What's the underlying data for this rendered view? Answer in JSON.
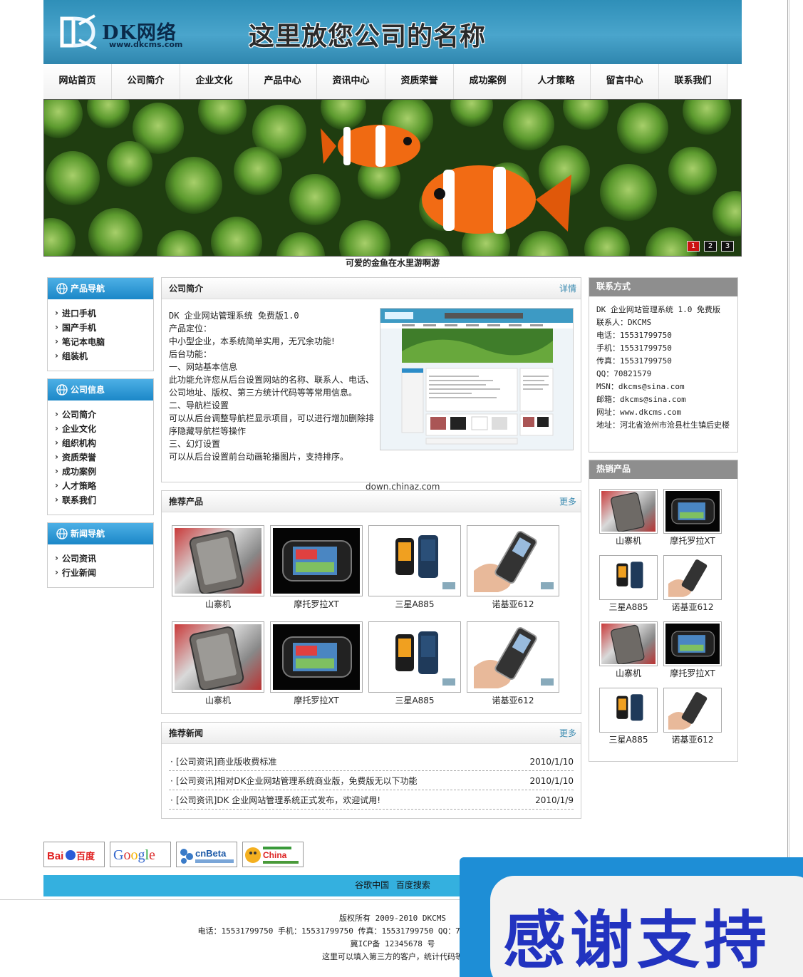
{
  "header": {
    "logo_brand": "DK网络",
    "logo_url": "www.dkcms.com",
    "company_name": "这里放您公司的名称"
  },
  "nav": [
    "网站首页",
    "公司简介",
    "企业文化",
    "产品中心",
    "资讯中心",
    "资质荣誉",
    "成功案例",
    "人才策略",
    "留言中心",
    "联系我们"
  ],
  "banner": {
    "caption": "可爱的金鱼在水里游啊游",
    "slides": [
      "1",
      "2",
      "3"
    ],
    "active_slide": 1
  },
  "left": {
    "product_nav": {
      "title": "产品导航",
      "items": [
        "进口手机",
        "国产手机",
        "笔记本电脑",
        "组装机"
      ]
    },
    "company_info": {
      "title": "公司信息",
      "items": [
        "公司简介",
        "企业文化",
        "组织机构",
        "资质荣誉",
        "成功案例",
        "人才策略",
        "联系我们"
      ]
    },
    "news_nav": {
      "title": "新闻导航",
      "items": [
        "公司资讯",
        "行业新闻"
      ]
    }
  },
  "about": {
    "title": "公司简介",
    "more": "详情",
    "lines": [
      "DK 企业网站管理系统 免费版1.0",
      "产品定位：",
      "中小型企业，本系统简单实用，无冗余功能!",
      "后台功能：",
      "一、网站基本信息",
      "此功能允许您从后台设置网站的名称、联系人、电话、",
      "公司地址、版权、第三方统计代码等等常用信息。",
      "二、导航栏设置",
      "可以从后台调整导航栏显示项目，可以进行增加删除排",
      "序隐藏导航栏等操作",
      "三、幻灯设置",
      "可以从后台设置前台动画轮播图片，支持排序。"
    ]
  },
  "watermark": "down.chinaz.com",
  "recommend": {
    "title": "推荐产品",
    "more": "更多",
    "products": [
      "山寨机",
      "摩托罗拉XT",
      "三星A885",
      "诺基亚612",
      "山寨机",
      "摩托罗拉XT",
      "三星A885",
      "诺基亚612"
    ]
  },
  "news": {
    "title": "推荐新闻",
    "more": "更多",
    "items": [
      {
        "title": "[公司资讯]商业版收费标准",
        "date": "2010/1/10"
      },
      {
        "title": "[公司资讯]相对DK企业网站管理系统商业版，免费版无以下功能",
        "date": "2010/1/10"
      },
      {
        "title": "[公司资讯]DK 企业网站管理系统正式发布，欢迎试用!",
        "date": "2010/1/9"
      }
    ]
  },
  "contact": {
    "title": "联系方式",
    "lines": [
      "DK 企业网站管理系统 1.0 免费版",
      "联系人：DKCMS",
      "电话：15531799750",
      "手机：15531799750",
      "传真：15531799750",
      "QQ：70821579",
      "MSN：dkcms@sina.com",
      "邮箱：dkcms@sina.com",
      "网址：www.dkcms.com",
      "地址：河北省沧州市沧县杜生镇后史楼"
    ]
  },
  "hot": {
    "title": "热销产品",
    "products": [
      "山寨机",
      "摩托罗拉XT",
      "三星A885",
      "诺基亚612",
      "山寨机",
      "摩托罗拉XT",
      "三星A885",
      "诺基亚612"
    ]
  },
  "friend_links": [
    "Baidu百度",
    "Google谷歌",
    "cnBeta.com中文业界资讯站",
    "China.com"
  ],
  "bottom_bar": [
    "谷歌中国",
    "百度搜索"
  ],
  "footer": {
    "copyright": "版权所有 2009-2010 DKCMS",
    "contact": "电话：15531799750 手机：15531799750 传真：15531799750 QQ：70821579 邮件：dkcms@sina.com",
    "icp": "冀ICP备 12345678 号",
    "stats": "这里可以填入第三方的客户，统计代码等"
  },
  "overlay": {
    "text": "感谢支持"
  },
  "colors": {
    "header_blue": "#3a9ac4",
    "side_head_blue": "#1b87c8",
    "bar_blue": "#34b0df",
    "right_head_gray": "#8e8e8e",
    "overlay_blue": "#1e8ed6",
    "overlay_text": "#2233c0"
  }
}
